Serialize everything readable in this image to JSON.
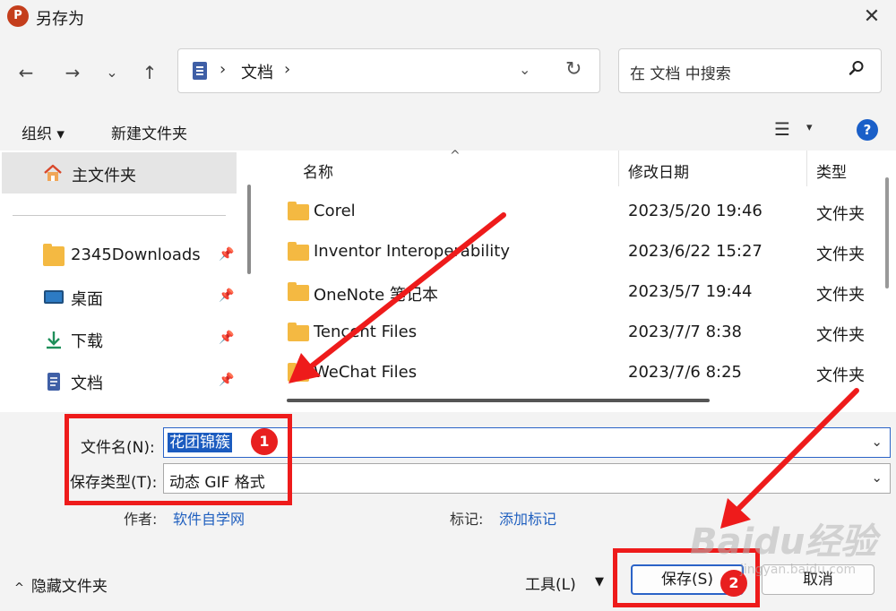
{
  "window": {
    "title": "另存为",
    "app_icon": "P",
    "close": "✕"
  },
  "nav": {
    "back": "←",
    "forward": "→",
    "recent": "⌄",
    "up": "↑",
    "address_sep1": "›",
    "address_path": "文档",
    "address_sep2": "›",
    "address_dropdown": "⌄",
    "refresh": "↻",
    "search_placeholder": "在 文档 中搜索"
  },
  "toolbar": {
    "organize": "组织 ▾",
    "new_folder": "新建文件夹",
    "view": "☰",
    "view_drop": "▾",
    "help": "?"
  },
  "sidebar": {
    "home": "主文件夹",
    "items": [
      {
        "label": "2345Downloads",
        "icon": "folder-icon",
        "pin": "📌"
      },
      {
        "label": "桌面",
        "icon": "desktop-icon",
        "pin": "📌"
      },
      {
        "label": "下载",
        "icon": "download-icon",
        "pin": "📌"
      },
      {
        "label": "文档",
        "icon": "document-icon",
        "pin": "📌"
      }
    ]
  },
  "files": {
    "sort_indicator": "^",
    "columns": {
      "name": "名称",
      "date": "修改日期",
      "type": "类型"
    },
    "rows": [
      {
        "name": "Corel",
        "date": "2023/5/20 19:46",
        "type": "文件夹"
      },
      {
        "name": "Inventor Interoperability",
        "date": "2023/6/22 15:27",
        "type": "文件夹"
      },
      {
        "name": "OneNote 笔记本",
        "date": "2023/5/7 19:44",
        "type": "文件夹"
      },
      {
        "name": "Tencent Files",
        "date": "2023/7/7 8:38",
        "type": "文件夹"
      },
      {
        "name": "WeChat Files",
        "date": "2023/7/6 8:25",
        "type": "文件夹"
      }
    ]
  },
  "form": {
    "filename_label": "文件名(N):",
    "filename_value": "花团锦簇",
    "filetype_label": "保存类型(T):",
    "filetype_value": "动态 GIF 格式",
    "chevron": "⌄",
    "author_label": "作者:",
    "author_value": "软件自学网",
    "tags_label": "标记:",
    "tags_value": "添加标记",
    "hide_folders": "隐藏文件夹",
    "hide_chevron": "^",
    "tools": "工具(L)",
    "tools_drop": "▼",
    "save": "保存(S)",
    "cancel": "取消"
  },
  "annotations": {
    "badge1": "1",
    "badge2": "2",
    "color": "#ee1b1b"
  },
  "watermark": {
    "text": "Baidu经验",
    "sub": "jingyan.baidu.com"
  },
  "colors": {
    "accent": "#2b63c7",
    "selection": "#1b5bbf",
    "folder": "#f4b942",
    "link": "#1f5fbf",
    "chrome": "#f3f3f3"
  }
}
